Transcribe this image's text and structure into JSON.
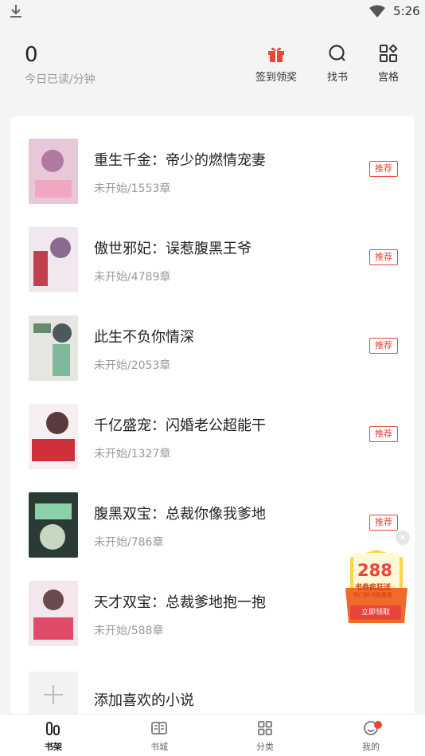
{
  "status": {
    "time": "5:26"
  },
  "header": {
    "count": "0",
    "count_label": "今日已读/分钟",
    "actions": [
      {
        "label": "签到领奖",
        "icon": "gift-icon"
      },
      {
        "label": "找书",
        "icon": "search-icon"
      },
      {
        "label": "宫格",
        "icon": "grid-icon"
      }
    ]
  },
  "books": [
    {
      "title": "重生千金：帝少的燃情宠妻",
      "progress": "未开始/1553章",
      "tag": "推荐"
    },
    {
      "title": "傲世邪妃：误惹腹黑王爷",
      "progress": "未开始/4789章",
      "tag": "推荐"
    },
    {
      "title": "此生不负你情深",
      "progress": "未开始/2053章",
      "tag": "推荐"
    },
    {
      "title": "千亿盛宠：闪婚老公超能干",
      "progress": "未开始/1327章",
      "tag": "推荐"
    },
    {
      "title": "腹黑双宝：总裁你像我爹地",
      "progress": "未开始/786章",
      "tag": "推荐"
    },
    {
      "title": "天才双宝：总裁爹地抱一抱",
      "progress": "未开始/588章"
    }
  ],
  "add": {
    "label": "添加喜欢的小说"
  },
  "promo": {
    "amount": "288",
    "line1": "书券疯狂送",
    "line2": "热门好书免费看",
    "button": "立即领取"
  },
  "tabs": [
    {
      "label": "书架",
      "icon": "bookshelf-icon",
      "active": true
    },
    {
      "label": "书城",
      "icon": "book-icon"
    },
    {
      "label": "分类",
      "icon": "category-icon"
    },
    {
      "label": "我的",
      "icon": "profile-icon"
    }
  ]
}
